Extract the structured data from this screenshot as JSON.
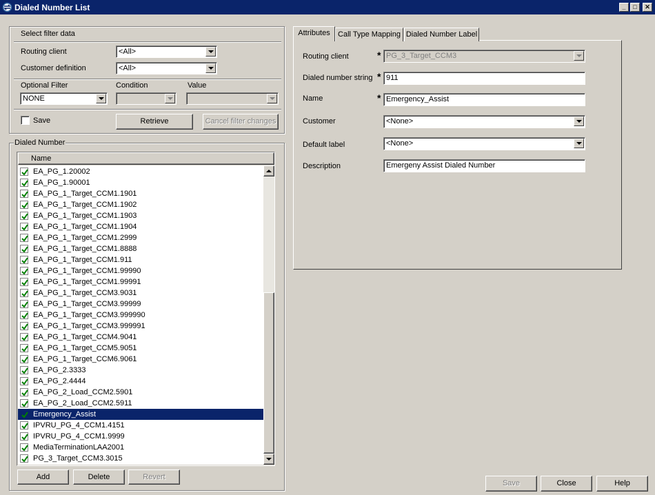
{
  "window": {
    "title": "Dialed Number List"
  },
  "filter": {
    "group_label": "Select filter data",
    "routing_client_label": "Routing client",
    "routing_client_value": "<All>",
    "customer_definition_label": "Customer definition",
    "customer_definition_value": "<All>",
    "optional_filter_label": "Optional Filter",
    "optional_filter_value": "NONE",
    "condition_label": "Condition",
    "value_label": "Value",
    "save_label": "Save",
    "retrieve_label": "Retrieve",
    "cancel_label": "Cancel filter changes"
  },
  "dialed_number": {
    "group_label": "Dialed Number",
    "column_name": "Name",
    "items": [
      "EA_PG_1.20002",
      "EA_PG_1.90001",
      "EA_PG_1_Target_CCM1.1901",
      "EA_PG_1_Target_CCM1.1902",
      "EA_PG_1_Target_CCM1.1903",
      "EA_PG_1_Target_CCM1.1904",
      "EA_PG_1_Target_CCM1.2999",
      "EA_PG_1_Target_CCM1.8888",
      "EA_PG_1_Target_CCM1.911",
      "EA_PG_1_Target_CCM1.99990",
      "EA_PG_1_Target_CCM1.99991",
      "EA_PG_1_Target_CCM3.9031",
      "EA_PG_1_Target_CCM3.99999",
      "EA_PG_1_Target_CCM3.999990",
      "EA_PG_1_Target_CCM3.999991",
      "EA_PG_1_Target_CCM4.9041",
      "EA_PG_1_Target_CCM5.9051",
      "EA_PG_1_Target_CCM6.9061",
      "EA_PG_2.3333",
      "EA_PG_2.4444",
      "EA_PG_2_Load_CCM2.5901",
      "EA_PG_2_Load_CCM2.5911",
      "Emergency_Assist",
      "IPVRU_PG_4_CCM1.4151",
      "IPVRU_PG_4_CCM1.9999",
      "MediaTerminationLAA2001",
      "PG_3_Target_CCM3.3015"
    ],
    "selected_index": 22,
    "add_label": "Add",
    "delete_label": "Delete",
    "revert_label": "Revert"
  },
  "tabs": [
    "Attributes",
    "Call Type Mapping",
    "Dialed Number Label"
  ],
  "attributes": {
    "routing_client_label": "Routing client",
    "routing_client_value": "PG_3_Target_CCM3",
    "dialed_number_string_label": "Dialed number string",
    "dialed_number_string_value": "911",
    "name_label": "Name",
    "name_value": "Emergency_Assist",
    "customer_label": "Customer",
    "customer_value": "<None>",
    "default_label_label": "Default label",
    "default_label_value": "<None>",
    "description_label": "Description",
    "description_value": "Emergeny Assist Dialed Number",
    "required_marker": "*"
  },
  "footer": {
    "save_label": "Save",
    "close_label": "Close",
    "help_label": "Help"
  },
  "window_controls": {
    "minimize": "_",
    "maximize": "□",
    "close": "✕"
  }
}
